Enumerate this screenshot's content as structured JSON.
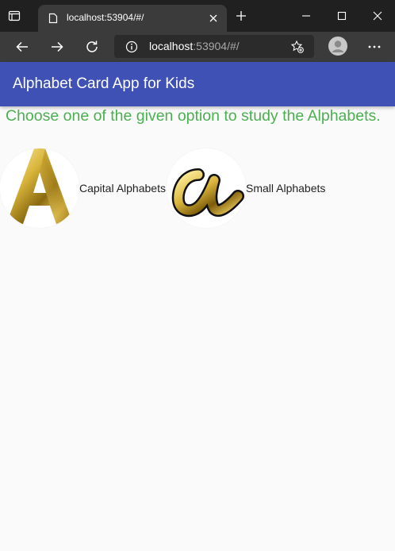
{
  "browser": {
    "tab_title": "localhost:53904/#/",
    "url_host": "localhost",
    "url_rest": ":53904/#/"
  },
  "app": {
    "title": "Alphabet Card App for Kids",
    "instruction": "Choose one of the given option to study the Alphabets.",
    "options": [
      {
        "label": "Capital Alphabets",
        "icon": "capital-a-gold-icon"
      },
      {
        "label": "Small Alphabets",
        "icon": "small-a-gold-icon"
      }
    ]
  },
  "colors": {
    "appbar": "#3f51b5",
    "instruction": "#4caf50",
    "gold": "#d4af37"
  }
}
